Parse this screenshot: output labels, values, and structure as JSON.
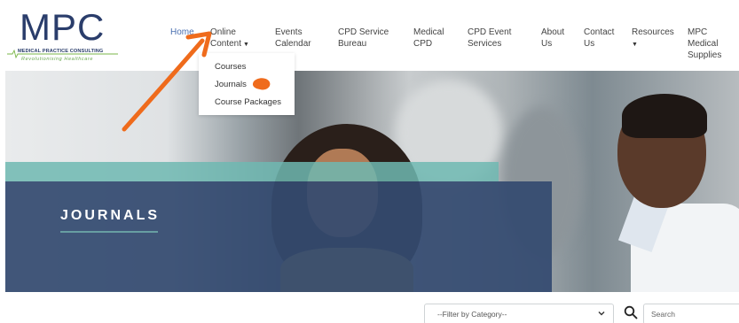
{
  "logo": {
    "mark": "MPC",
    "subtitle": "MEDICAL PRACTICE CONSULTING",
    "tagline": "Revolutionising Healthcare"
  },
  "nav": {
    "home": "Home",
    "online_content_line1": "Online",
    "online_content_line2": "Content",
    "events_line1": "Events",
    "events_line2": "Calendar",
    "cpd_bureau_line1": "CPD Service",
    "cpd_bureau_line2": "Bureau",
    "medical_cpd_line1": "Medical",
    "medical_cpd_line2": "CPD",
    "cpd_event_line1": "CPD Event",
    "cpd_event_line2": "Services",
    "about_line1": "About",
    "about_line2": "Us",
    "contact_line1": "Contact",
    "contact_line2": "Us",
    "resources": "Resources",
    "supplies_line1": "MPC Medical",
    "supplies_line2": "Supplies",
    "caret_icon": "caret-down-icon"
  },
  "dropdown": {
    "items": [
      "Courses",
      "Journals",
      "Course Packages"
    ]
  },
  "hero": {
    "title": "JOURNALS"
  },
  "filter": {
    "selected": "--Filter by Category--"
  },
  "search": {
    "placeholder": "Search"
  },
  "colors": {
    "brand_navy": "#2a3d6b",
    "nav_active": "#4a6fb0",
    "teal_band": "#6eb9b2",
    "navy_box": "#344a70",
    "annotation": "#ef6b1c"
  }
}
